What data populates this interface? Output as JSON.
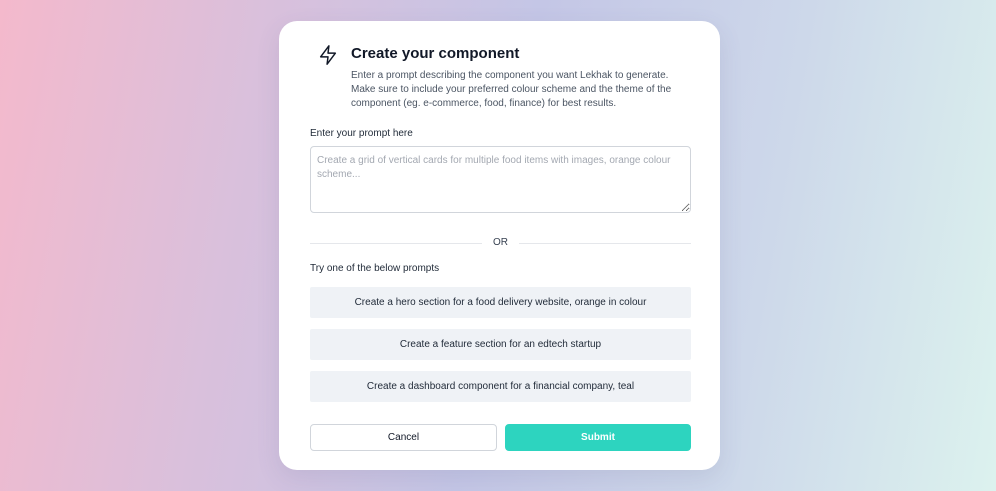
{
  "modal": {
    "title": "Create your component",
    "description": "Enter a prompt describing the component you want Lekhak to generate. Make sure to include your preferred colour scheme and the theme of the component (eg. e-commerce, food, finance) for best results.",
    "icon": "bolt-icon"
  },
  "prompt": {
    "label": "Enter your prompt here",
    "value": "",
    "placeholder": "Create a grid of vertical cards for multiple food items with images, orange colour scheme..."
  },
  "divider": {
    "text": "OR"
  },
  "suggestions": {
    "label": "Try one of the below prompts",
    "items": [
      "Create a hero section for a food delivery website, orange in colour",
      "Create a feature section for an edtech startup",
      "Create a dashboard component for a financial company, teal"
    ]
  },
  "actions": {
    "cancel_label": "Cancel",
    "submit_label": "Submit",
    "submit_color": "#2dd4bf"
  }
}
